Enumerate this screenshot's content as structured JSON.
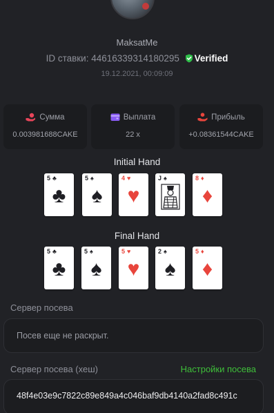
{
  "header": {
    "username": "MaksatMe",
    "bet_id_label": "ID ставки:",
    "bet_id": "44616339314180295",
    "verified_label": "Verified",
    "date": "19.12.2021, 00:09:09"
  },
  "stats": [
    {
      "label": "Сумма",
      "value": "0.003981688CAKE",
      "icon": "hand-coins-icon",
      "icon_color": "#e8455a"
    },
    {
      "label": "Выплата",
      "value": "22 x",
      "icon": "wallet-icon",
      "icon_color": "#8a5cf5"
    },
    {
      "label": "Прибыль",
      "value": "+0.08361544CAKE",
      "icon": "hand-user-icon",
      "icon_color": "#e8453c"
    }
  ],
  "initial_hand": {
    "title": "Initial Hand",
    "cards": [
      {
        "rank": "5",
        "suit": "♣",
        "color": "black"
      },
      {
        "rank": "5",
        "suit": "♠",
        "color": "black"
      },
      {
        "rank": "4",
        "suit": "♥",
        "color": "red"
      },
      {
        "rank": "J",
        "suit": "♠",
        "color": "black"
      },
      {
        "rank": "8",
        "suit": "♦",
        "color": "red"
      }
    ]
  },
  "final_hand": {
    "title": "Final Hand",
    "cards": [
      {
        "rank": "5",
        "suit": "♣",
        "color": "black"
      },
      {
        "rank": "5",
        "suit": "♠",
        "color": "black"
      },
      {
        "rank": "5",
        "suit": "♥",
        "color": "red"
      },
      {
        "rank": "2",
        "suit": "♠",
        "color": "black"
      },
      {
        "rank": "5",
        "suit": "♦",
        "color": "red"
      }
    ]
  },
  "server_seed": {
    "label": "Сервер посева",
    "value": "Посев еще не раскрыт."
  },
  "server_seed_hash": {
    "label": "Сервер посева (хеш)",
    "link": "Настройки посева",
    "value": "48f4e03e9c7822c89e849a4c046baf9db4140a2fad8c491c"
  },
  "colors": {
    "background": "#212226",
    "card_bg": "#1b1c1f",
    "accent_green": "#3fbf3a",
    "verified_green": "#2fbf4a"
  }
}
